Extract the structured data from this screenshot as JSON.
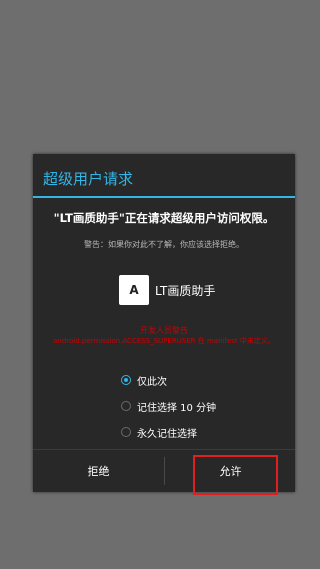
{
  "dialog": {
    "title": "超级用户请求",
    "request_text": "\"LT画质助手\"正在请求超级用户访问权限。",
    "warning_text": "警告：如果你对此不了解，你应该选择拒绝。",
    "app": {
      "icon_glyph": "A",
      "name": "LT画质助手"
    },
    "developer_warning_title": "开发人员警告",
    "developer_warning_body": "android.permission.ACCESS_SUPERUSER 在 manifest 中未定义。",
    "options": [
      {
        "label": "仅此次",
        "selected": true
      },
      {
        "label": "记住选择 10 分钟",
        "selected": false
      },
      {
        "label": "永久记住选择",
        "selected": false
      }
    ],
    "buttons": {
      "deny": "拒绝",
      "allow": "允许"
    }
  },
  "colors": {
    "accent": "#33b5e5",
    "warning": "#cc0000",
    "highlight": "#e02020"
  }
}
